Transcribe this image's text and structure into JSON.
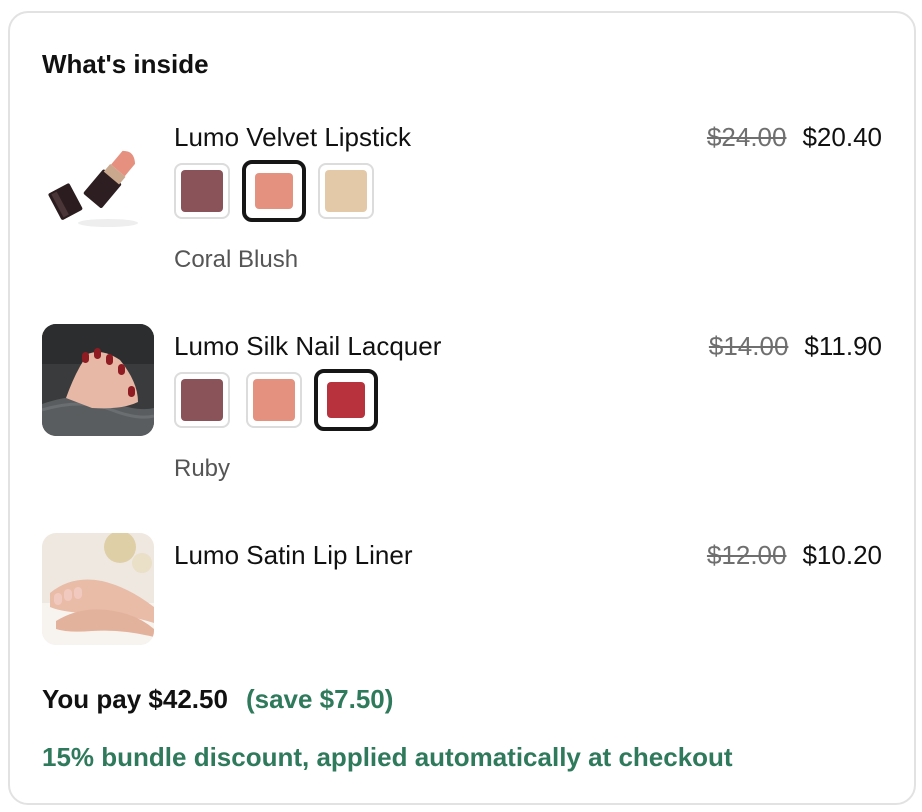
{
  "section": {
    "title": "What's inside"
  },
  "items": [
    {
      "name": "Lumo Velvet Lipstick",
      "original_price": "$24.00",
      "price": "$20.40",
      "image_icon": "lipstick-photo",
      "swatches": [
        {
          "color": "#8a5259",
          "selected": false
        },
        {
          "color": "#e4917f",
          "selected": true
        },
        {
          "color": "#e4c9a8",
          "selected": false
        }
      ],
      "selected_shade": "Coral Blush"
    },
    {
      "name": "Lumo Silk Nail Lacquer",
      "original_price": "$14.00",
      "price": "$11.90",
      "image_icon": "nail-lacquer-photo",
      "swatches": [
        {
          "color": "#8a5259",
          "selected": false
        },
        {
          "color": "#e4917f",
          "selected": false
        },
        {
          "color": "#b8323d",
          "selected": true
        }
      ],
      "selected_shade": "Ruby"
    },
    {
      "name": "Lumo Satin Lip Liner",
      "original_price": "$12.00",
      "price": "$10.20",
      "image_icon": "hands-photo"
    }
  ],
  "summary": {
    "you_pay": "You pay $42.50",
    "save": "(save $7.50)",
    "discount_note": "15% bundle discount, applied automatically at checkout"
  },
  "colors": {
    "accent_green": "#2f7a5c",
    "border": "#e2e2e2"
  }
}
